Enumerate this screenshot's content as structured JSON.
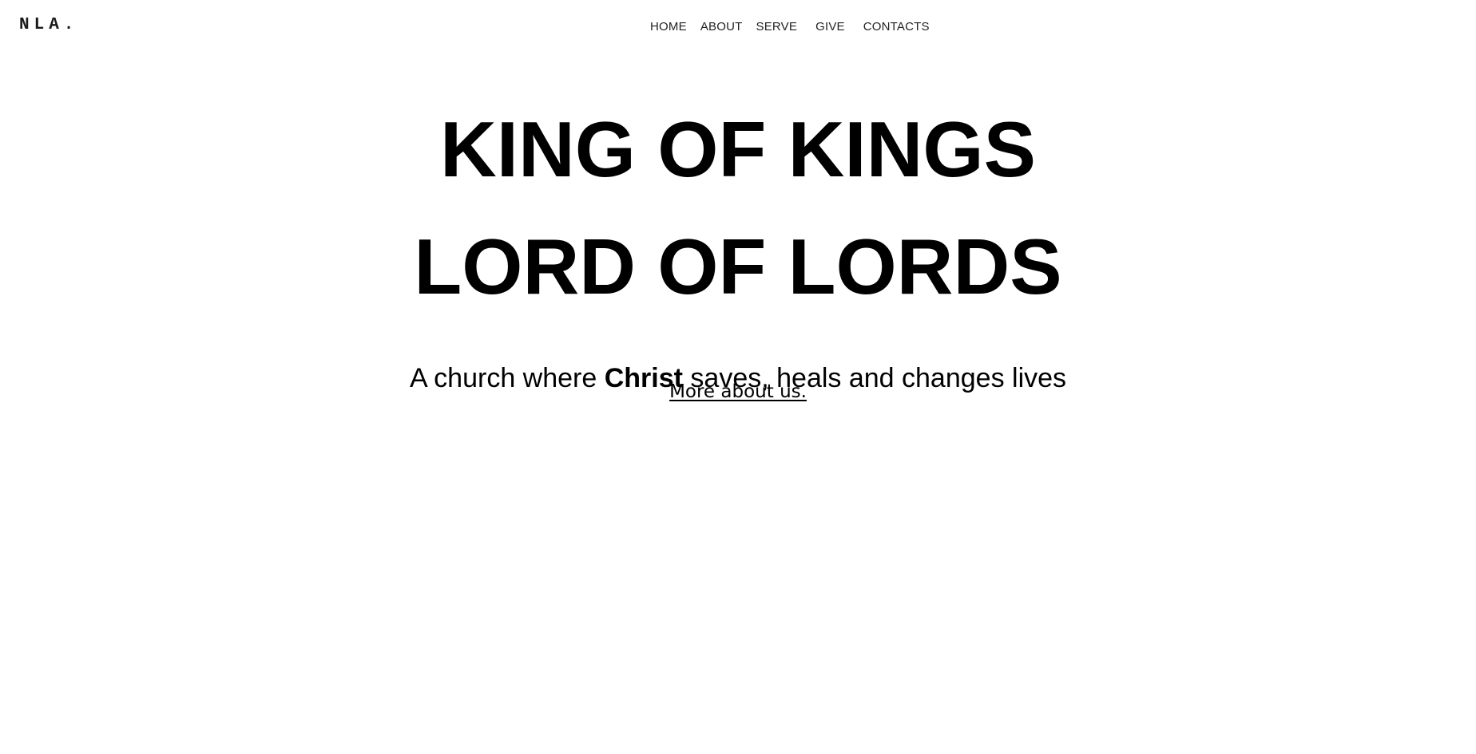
{
  "header": {
    "logo": "NLA.",
    "nav": [
      {
        "label": "HOME"
      },
      {
        "label": "ABOUT"
      },
      {
        "label": "SERVE"
      },
      {
        "label": "GIVE"
      },
      {
        "label": "CONTACTS"
      }
    ]
  },
  "hero": {
    "line1": "KING OF KINGS",
    "line2": "LORD OF LORDS",
    "tagline_before": "A church where ",
    "tagline_bold": "Christ",
    "tagline_after": " saves, heals and changes lives",
    "more_link": "More about us."
  }
}
